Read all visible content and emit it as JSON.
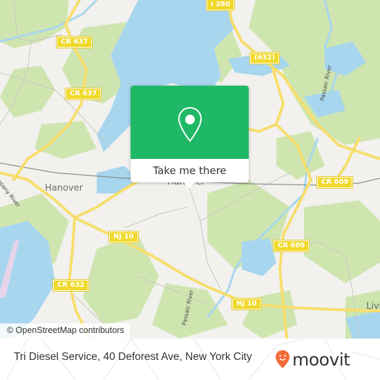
{
  "map": {
    "place_labels": [
      {
        "id": "hanover-west",
        "text": "Hanover"
      },
      {
        "id": "hanover-center",
        "text": "Hanover"
      },
      {
        "id": "livingston",
        "text": "Livi"
      }
    ],
    "road_shields": [
      {
        "id": "cr637-north",
        "text": "CR 637"
      },
      {
        "id": "cr637-south",
        "text": "CR 637"
      },
      {
        "id": "i280",
        "text": "I 280"
      },
      {
        "id": "cr632-north",
        "text": "(632)"
      },
      {
        "id": "cr609-north",
        "text": "CR 609"
      },
      {
        "id": "cr609-south",
        "text": "CR 609"
      },
      {
        "id": "nj10-west",
        "text": "NJ 10"
      },
      {
        "id": "nj10-east",
        "text": "NJ 10"
      },
      {
        "id": "cr632-south",
        "text": "CR 632"
      }
    ],
    "river_labels": [
      {
        "id": "passaic-north",
        "text": "Passaic River"
      },
      {
        "id": "passaic-south",
        "text": "Passaic River"
      },
      {
        "id": "whippany",
        "text": "Whippany River"
      }
    ],
    "attribution": "© OpenStreetMap contributors",
    "colors": {
      "land": "#f2f1ee",
      "forest": "#cfe5b0",
      "water": "#a7d6ee",
      "road": "#f7de6b",
      "shield": "#f0d92a"
    }
  },
  "popup": {
    "icon": "map-pin-icon",
    "button_label": "Take me there",
    "color": "#1fb866"
  },
  "footer": {
    "title": "Tri Diesel Service, 40 Deforest Ave, New York City",
    "brand": "moovit",
    "brand_color": "#f26b3a"
  }
}
